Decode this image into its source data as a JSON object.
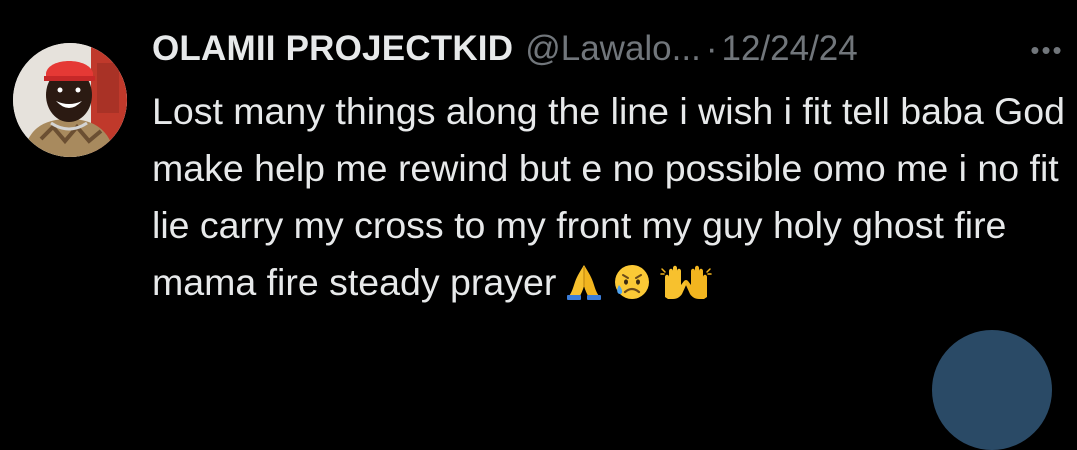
{
  "tweet": {
    "display_name": "OLAMII PROJECTKID",
    "handle": "@Lawalo...",
    "separator": "·",
    "date": "12/24/24",
    "more_label": "•••",
    "text": "Lost many things along the line i wish i fit tell baba God make help me rewind but e no possible omo me i no fit lie carry my cross to my front my guy holy ghost fire mama fire steady prayer",
    "emojis": [
      "folded-hands-emoji",
      "sad-but-relieved-face-emoji",
      "raising-hands-emoji"
    ]
  },
  "colors": {
    "background": "#000000",
    "primary_text": "#e7e9ea",
    "secondary_text": "#71767b",
    "fab": "#2a4a66"
  }
}
